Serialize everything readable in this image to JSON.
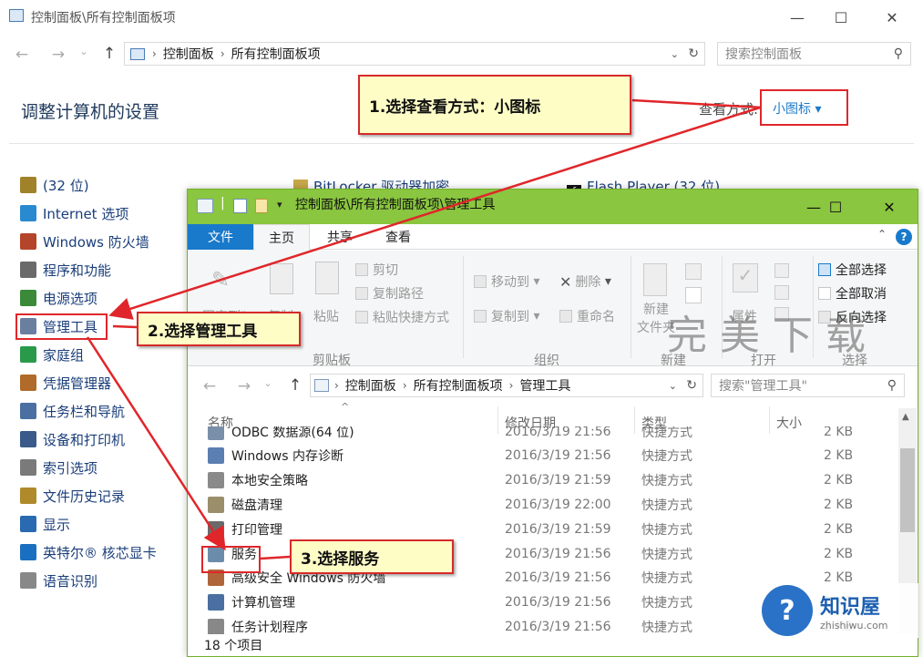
{
  "cp_window": {
    "title": "控制面板\\所有控制面板项",
    "breadcrumb": [
      "控制面板",
      "所有控制面板项"
    ],
    "search_placeholder": "搜索控制面板",
    "heading": "调整计算机的设置",
    "view_by_label": "查看方式:",
    "view_by_value": "小图标 ▾",
    "items_col1": [
      {
        "label": "(32 位)",
        "icon": "java-icon"
      },
      {
        "label": "Internet 选项",
        "icon": "globe-icon"
      },
      {
        "label": "Windows 防火墙",
        "icon": "firewall-icon"
      },
      {
        "label": "程序和功能",
        "icon": "programs-icon"
      },
      {
        "label": "电源选项",
        "icon": "power-icon"
      },
      {
        "label": "管理工具",
        "icon": "admin-tools-icon"
      },
      {
        "label": "家庭组",
        "icon": "homegroup-icon"
      },
      {
        "label": "凭据管理器",
        "icon": "credentials-icon"
      },
      {
        "label": "任务栏和导航",
        "icon": "taskbar-icon"
      },
      {
        "label": "设备和打印机",
        "icon": "printer-icon"
      },
      {
        "label": "索引选项",
        "icon": "index-icon"
      },
      {
        "label": "文件历史记录",
        "icon": "history-icon"
      },
      {
        "label": "显示",
        "icon": "display-icon"
      },
      {
        "label": "英特尔® 核芯显卡",
        "icon": "intel-icon"
      },
      {
        "label": "语音识别",
        "icon": "microphone-icon"
      }
    ],
    "item_col2": "BitLocker 驱动器加密",
    "item_col3": "Flash Player (32 位)"
  },
  "explorer": {
    "title": "控制面板\\所有控制面板项\\管理工具",
    "tabs": [
      "文件",
      "主页",
      "共享",
      "查看"
    ],
    "ribbon": {
      "pin": "固定到\"",
      "copy": "复制",
      "paste": "粘贴",
      "cut": "剪切",
      "copy_path": "复制路径",
      "paste_shortcut": "粘贴快捷方式",
      "move_to": "移动到",
      "copy_to": "复制到",
      "delete": "删除",
      "rename": "重命名",
      "new": "新建",
      "new_folder": "文件夹",
      "properties": "属性",
      "select_all": "全部选择",
      "select_none": "全部取消",
      "invert": "反向选择",
      "groups": [
        "剪贴板",
        "组织",
        "新建",
        "打开",
        "选择"
      ]
    },
    "breadcrumb": [
      "控制面板",
      "所有控制面板项",
      "管理工具"
    ],
    "search_placeholder": "搜索\"管理工具\"",
    "columns": [
      "名称",
      "修改日期",
      "类型",
      "大小"
    ],
    "rows": [
      {
        "name": "ODBC 数据源(64 位)",
        "date": "2016/3/19 21:56",
        "type": "快捷方式",
        "size": "2 KB",
        "color": "#7a8fa8"
      },
      {
        "name": "Windows 内存诊断",
        "date": "2016/3/19 21:56",
        "type": "快捷方式",
        "size": "2 KB",
        "color": "#5a7fb0"
      },
      {
        "name": "本地安全策略",
        "date": "2016/3/19 21:59",
        "type": "快捷方式",
        "size": "2 KB",
        "color": "#8a8a8a"
      },
      {
        "name": "磁盘清理",
        "date": "2016/3/19 22:00",
        "type": "快捷方式",
        "size": "2 KB",
        "color": "#9a8f6a"
      },
      {
        "name": "打印管理",
        "date": "2016/3/19 21:59",
        "type": "快捷方式",
        "size": "2 KB",
        "color": "#6a6a6a"
      },
      {
        "name": "服务",
        "date": "2016/3/19 21:56",
        "type": "快捷方式",
        "size": "2 KB",
        "color": "#6c8cab"
      },
      {
        "name": "高级安全 Windows 防火墙",
        "date": "2016/3/19 21:56",
        "type": "快捷方式",
        "size": "2 KB",
        "color": "#b0653a"
      },
      {
        "name": "计算机管理",
        "date": "2016/3/19 21:56",
        "type": "快捷方式",
        "size": "2 KB",
        "color": "#4a6fa0"
      },
      {
        "name": "任务计划程序",
        "date": "2016/3/19 21:56",
        "type": "快捷方式",
        "size": "2 KB",
        "color": "#888"
      }
    ],
    "status": "18 个项目"
  },
  "callouts": {
    "step1": "1.选择查看方式：小图标",
    "step2": "2.选择管理工具",
    "step3": "3.选择服务"
  },
  "watermarks": {
    "brand1": "完美下载",
    "brand2": "知识屋",
    "brand2_url": "zhishiwu.com"
  },
  "colors": {
    "accent": "#1979ca",
    "title_green": "#8ac63f",
    "highlight_red": "#e0262a"
  }
}
